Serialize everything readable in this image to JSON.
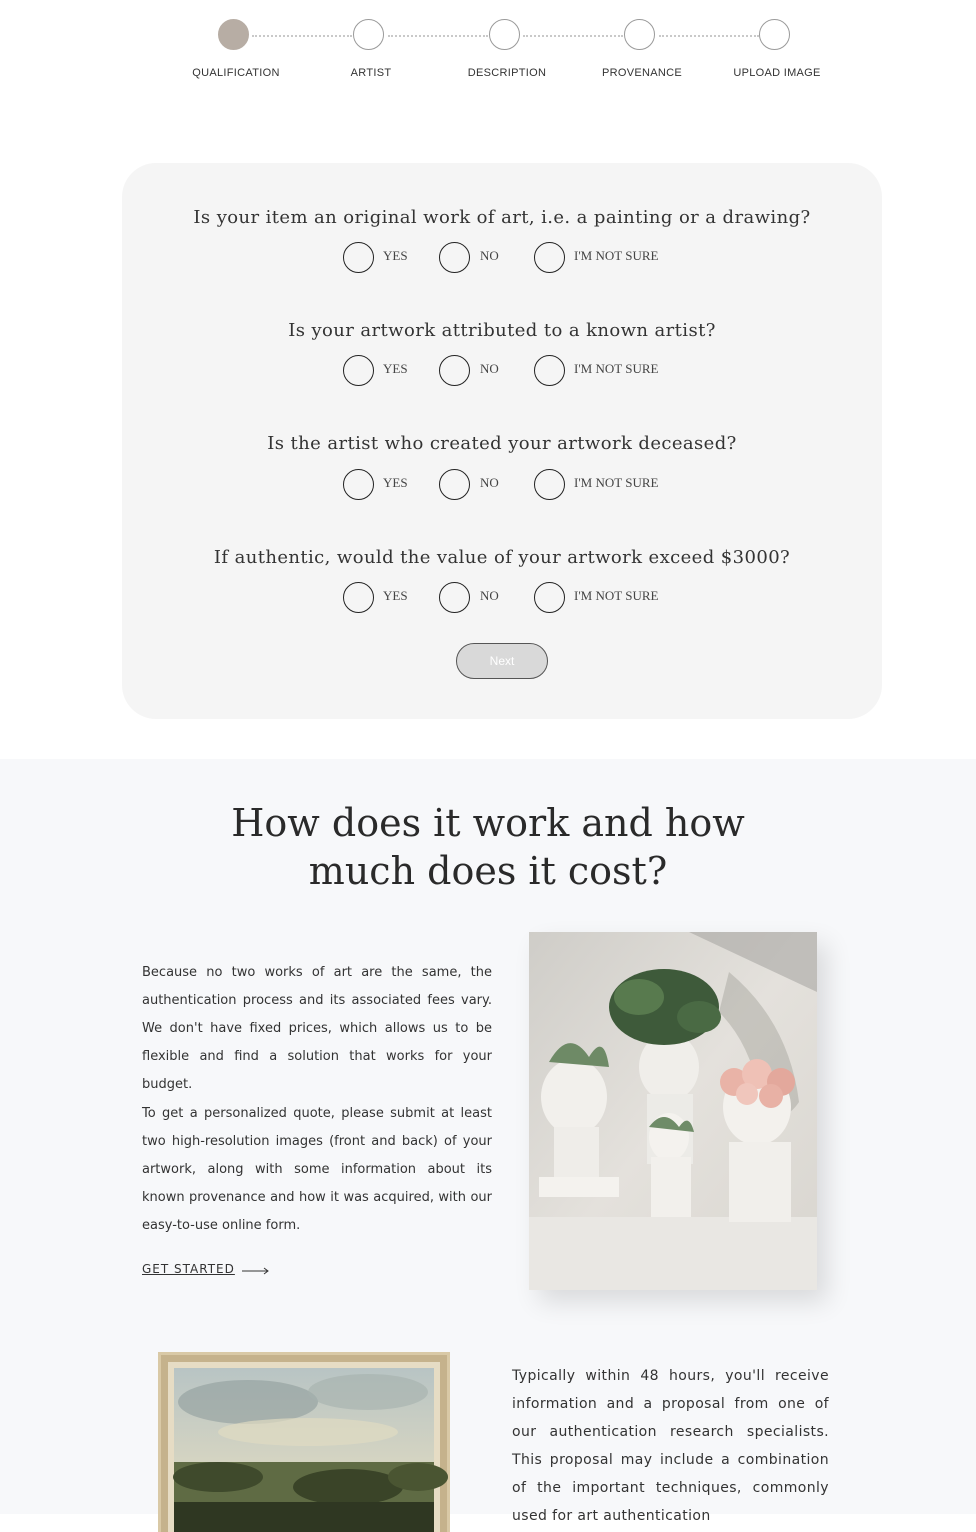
{
  "stepper": {
    "steps": [
      {
        "label": "QUALIFICATION",
        "active": true
      },
      {
        "label": "ARTIST",
        "active": false
      },
      {
        "label": "DESCRIPTION",
        "active": false
      },
      {
        "label": "PROVENANCE",
        "active": false
      },
      {
        "label": "UPLOAD IMAGE",
        "active": false
      }
    ]
  },
  "form": {
    "questions": [
      {
        "text": "Is your item an original work of art, i.e. a painting or a drawing?"
      },
      {
        "text": "Is your artwork attributed to a known artist?"
      },
      {
        "text": "Is the artist who created your artwork deceased?"
      },
      {
        "text": "If authentic, would the value of your artwork exceed $3000?"
      }
    ],
    "options": [
      "YES",
      "NO",
      "I'M NOT SURE"
    ],
    "next_label": "Next"
  },
  "info": {
    "title": "How does it work and how much does it cost?",
    "paragraph1": "Because no two works of art are the same, the authentication process and its associated fees vary. We don't have fixed prices, which allows us to be flexible and find a solution that works for your budget.",
    "paragraph2": "To get a personalized quote, please submit at least two high-resolution images (front and back) of your artwork, along with some information about its known provenance and how it was acquired, with our easy-to-use online form.",
    "cta_label": "GET STARTED",
    "paragraph3": "Typically within 48 hours, you'll receive information and a proposal from one of our authentication research specialists. This proposal may include a combination of the important techniques, commonly used for art authentication"
  },
  "colors": {
    "active_step": "#b7ada4",
    "card_bg": "#f5f5f5",
    "section_bg": "#f7f8fa"
  }
}
